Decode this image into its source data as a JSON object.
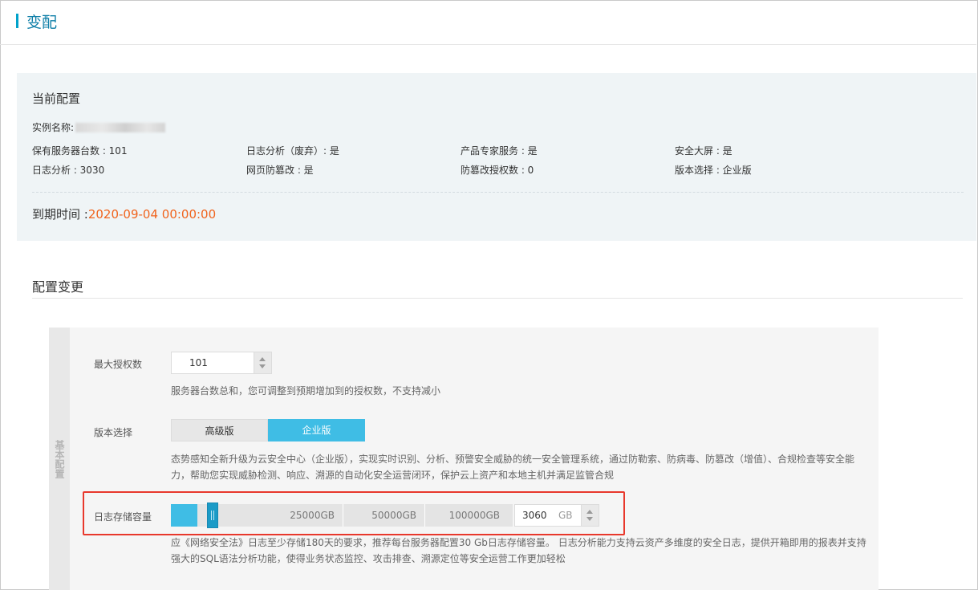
{
  "header": {
    "title": "变配"
  },
  "current_config": {
    "heading": "当前配置",
    "instance_label": "实例名称:",
    "items": [
      {
        "label": "保有服务器台数 : 101"
      },
      {
        "label": "日志分析（废弃）: 是"
      },
      {
        "label": "产品专家服务 : 是"
      },
      {
        "label": "安全大屏 : 是"
      },
      {
        "label": "日志分析 : 3030"
      },
      {
        "label": "网页防篡改 : 是"
      },
      {
        "label": "防篡改授权数 : 0"
      },
      {
        "label": "版本选择 : 企业版"
      }
    ],
    "expire_label": "到期时间 :",
    "expire_value": "2020-09-04 00:00:00"
  },
  "config_change": {
    "title": "配置变更",
    "section_label": "基本配置",
    "max_license": {
      "label": "最大授权数",
      "value": "101",
      "hint": "服务器台数总和，您可调整到预期增加到的授权数，不支持减小"
    },
    "version": {
      "label": "版本选择",
      "options": [
        "高级版",
        "企业版"
      ],
      "selected": "企业版",
      "hint_line1": "态势感知全新升级为云安全中心（企业版），实现实时识别、分析、预警安全威胁的统一安全管理系统，通过防勒索、防病毒、防篡改（增值）、合规检查等安全能",
      "hint_line2": "力，帮助您实现威胁检测、响应、溯源的自动化安全运营闭环，保护云上资产和本地主机并满足监管合规"
    },
    "log_storage": {
      "label": "日志存储容量",
      "marks": [
        "25000GB",
        "50000GB",
        "100000GB"
      ],
      "value": "3060",
      "unit": "GB",
      "slider_fraction": 0.03,
      "hint_line1": "应《网络安全法》日志至少存储180天的要求，推荐每台服务器配置30 Gb日志存储容量。 日志分析能力支持云资产多维度的安全日志，提供开箱即用的报表并支持",
      "hint_line2": "强大的SQL语法分析功能，使得业务状态监控、攻击排查、溯源定位等安全运营工作更加轻松"
    }
  },
  "colors": {
    "accent": "#3fbde5",
    "expire": "#f0641e",
    "highlight": "#e8382c"
  }
}
